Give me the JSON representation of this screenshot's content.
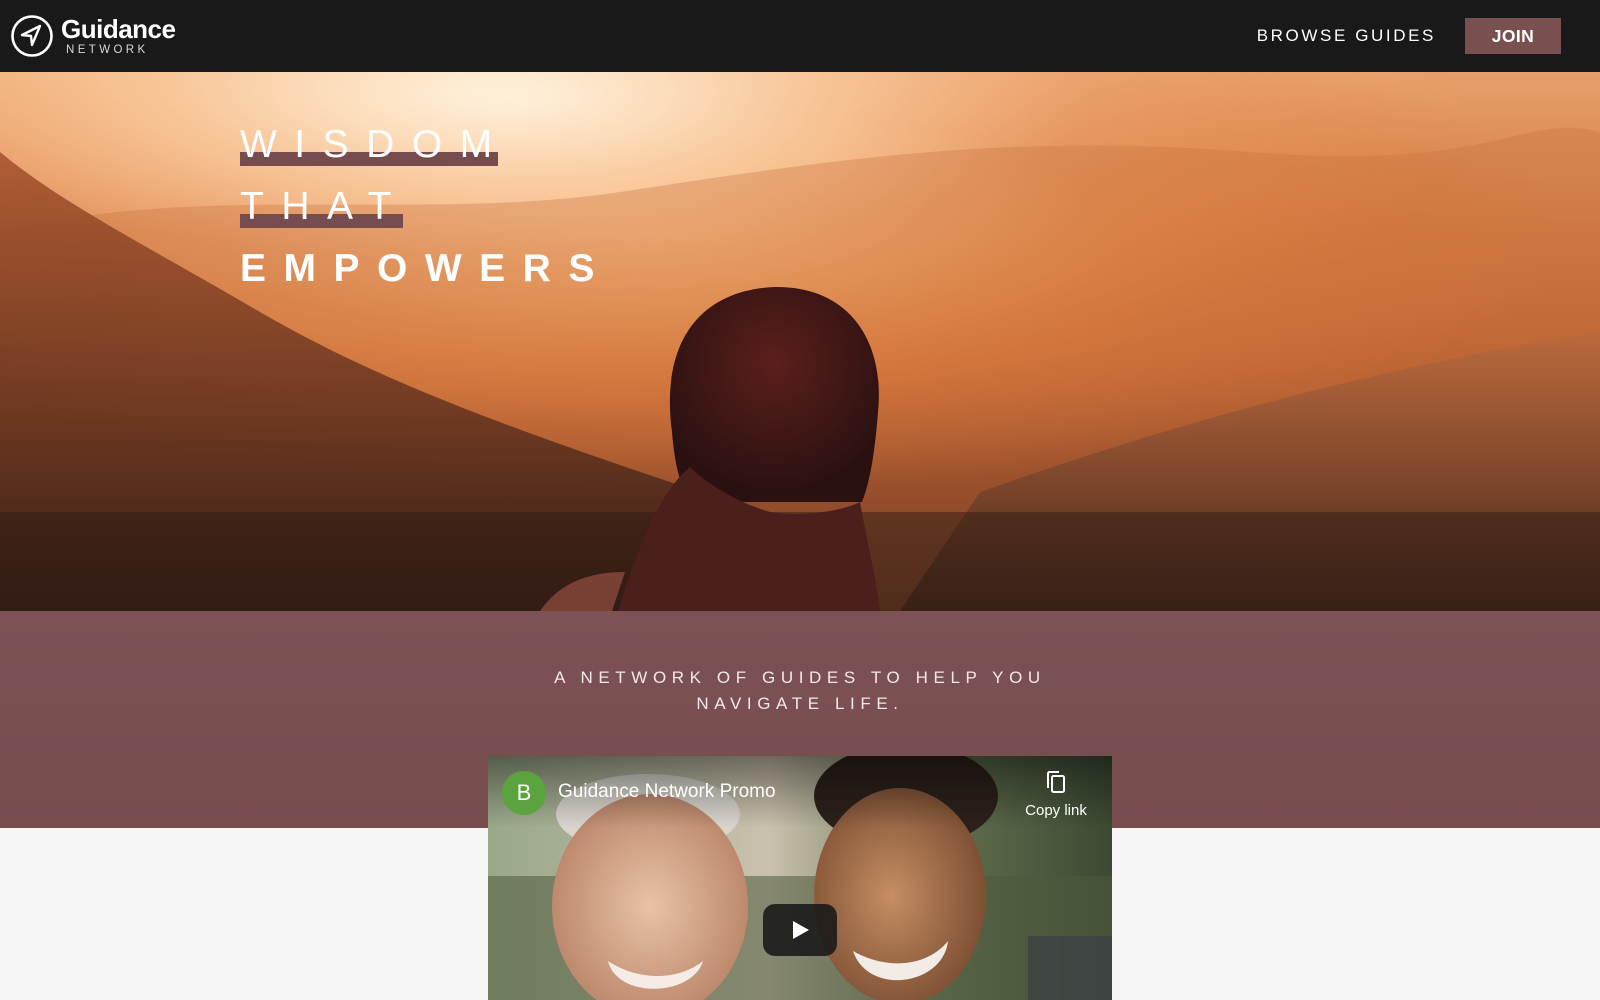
{
  "header": {
    "brand_name": "Guidance",
    "brand_sub": "NETWORK",
    "logo_icon": "compass-arrow-icon",
    "nav_browse": "BROWSE GUIDES",
    "join_label": "JOIN"
  },
  "hero": {
    "line1": "WISDOM",
    "line2": "THAT",
    "line3": "EMPOWERS"
  },
  "band": {
    "tagline_line1": "A NETWORK OF GUIDES TO HELP YOU",
    "tagline_line2": "NAVIGATE LIFE."
  },
  "video": {
    "channel_initial": "B",
    "title": "Guidance Network Promo",
    "copy_link_label": "Copy link",
    "play_icon": "play-icon"
  },
  "colors": {
    "header_bg": "#191919",
    "accent": "#7a4f50",
    "band_bg": "#7a5052",
    "avatar_green": "#5aa33d"
  }
}
